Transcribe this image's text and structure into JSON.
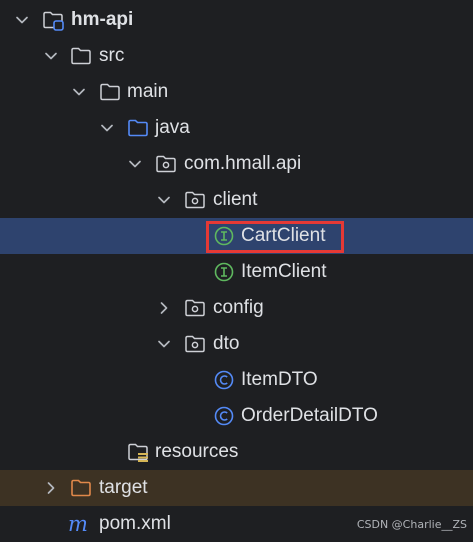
{
  "tree": {
    "items": [
      {
        "label": "hm-api",
        "icon": "module-folder-icon",
        "expanded": true
      },
      {
        "label": "src",
        "icon": "folder-icon",
        "expanded": true
      },
      {
        "label": "main",
        "icon": "folder-icon",
        "expanded": true
      },
      {
        "label": "java",
        "icon": "source-root-folder-icon",
        "expanded": true
      },
      {
        "label": "com.hmall.api",
        "icon": "package-icon",
        "expanded": true
      },
      {
        "label": "client",
        "icon": "package-icon",
        "expanded": true
      },
      {
        "label": "CartClient",
        "icon": "interface-icon",
        "selected": true
      },
      {
        "label": "ItemClient",
        "icon": "interface-icon"
      },
      {
        "label": "config",
        "icon": "package-icon",
        "expanded": false
      },
      {
        "label": "dto",
        "icon": "package-icon",
        "expanded": true
      },
      {
        "label": "ItemDTO",
        "icon": "class-icon"
      },
      {
        "label": "OrderDetailDTO",
        "icon": "class-icon"
      },
      {
        "label": "resources",
        "icon": "resources-folder-icon"
      },
      {
        "label": "target",
        "icon": "excluded-folder-icon",
        "expanded": false
      },
      {
        "label": "pom.xml",
        "icon": "maven-icon"
      }
    ]
  },
  "colors": {
    "background": "#1e1f22",
    "selected_row": "#2e436e",
    "excluded_row": "#3d3223",
    "highlight_border": "#e53935",
    "interface_icon": "#5fb85f",
    "class_icon": "#548af7",
    "excluded_folder": "#e0884a"
  },
  "watermark": "CSDN @Charlie__ZS"
}
